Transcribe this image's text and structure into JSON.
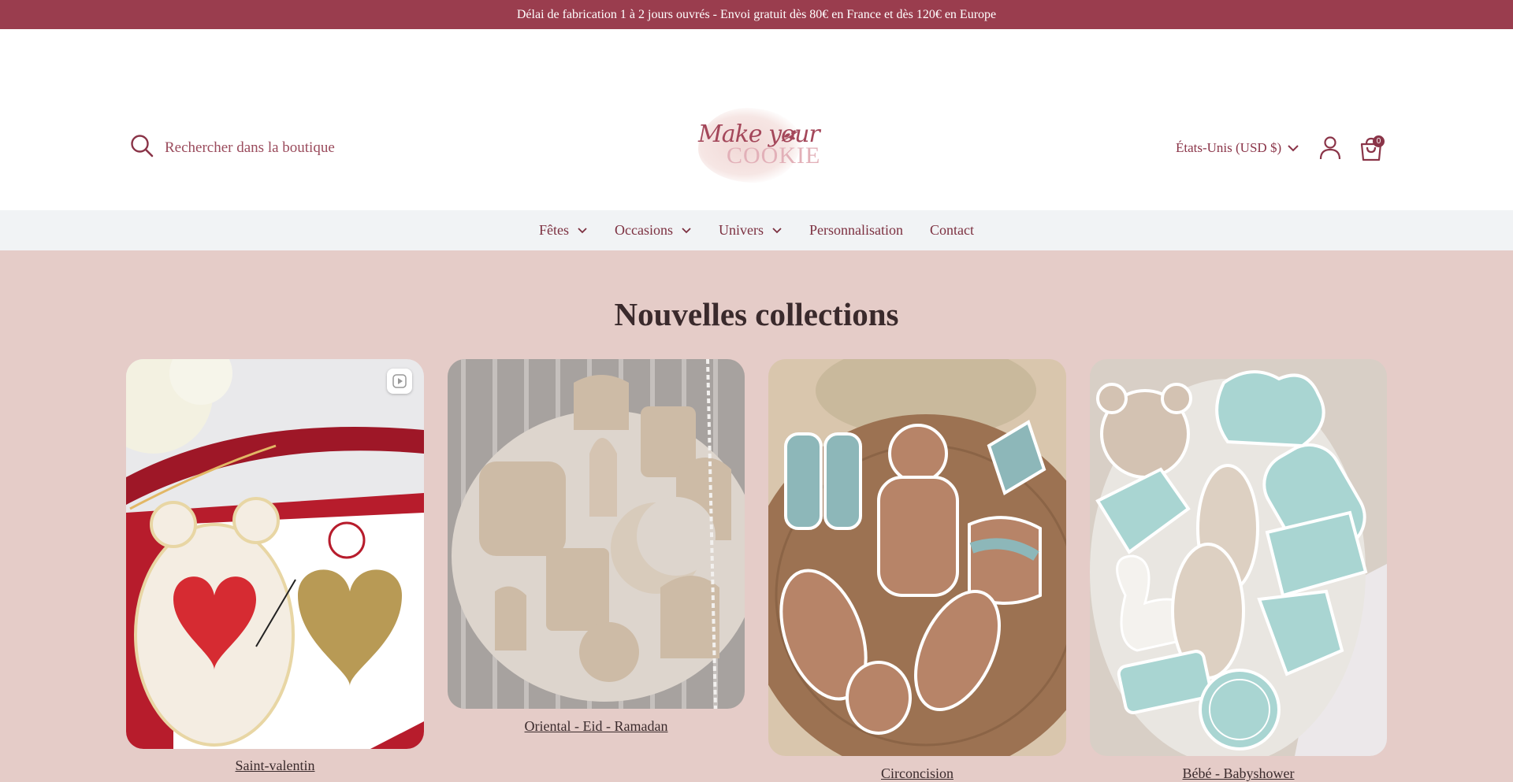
{
  "announcement": "Délai de fabrication 1 à 2 jours ouvrés - Envoi gratuit dès 80€ en France et dès 120€ en Europe",
  "search": {
    "placeholder": "Rechercher dans la boutique",
    "icon": "search-icon"
  },
  "logo": {
    "line1": "Make your",
    "line2": "COOKIE"
  },
  "header": {
    "currency": "États-Unis (USD $)",
    "cart_count": "0"
  },
  "nav": {
    "items": [
      {
        "label": "Fêtes",
        "has_dropdown": true
      },
      {
        "label": "Occasions",
        "has_dropdown": true
      },
      {
        "label": "Univers",
        "has_dropdown": true
      },
      {
        "label": "Personnalisation",
        "has_dropdown": false
      },
      {
        "label": "Contact",
        "has_dropdown": false
      }
    ]
  },
  "main": {
    "section_title": "Nouvelles collections",
    "collections": [
      {
        "label": "Saint-valentin"
      },
      {
        "label": "Oriental - Eid - Ramadan"
      },
      {
        "label": "Circoncision"
      },
      {
        "label": "Bébé - Babyshower"
      }
    ]
  },
  "colors": {
    "announce_bg": "#9a3d4e",
    "accent": "#8a3448",
    "page_bg": "#e5ccc8",
    "nav_bg": "#f1f3f5"
  }
}
